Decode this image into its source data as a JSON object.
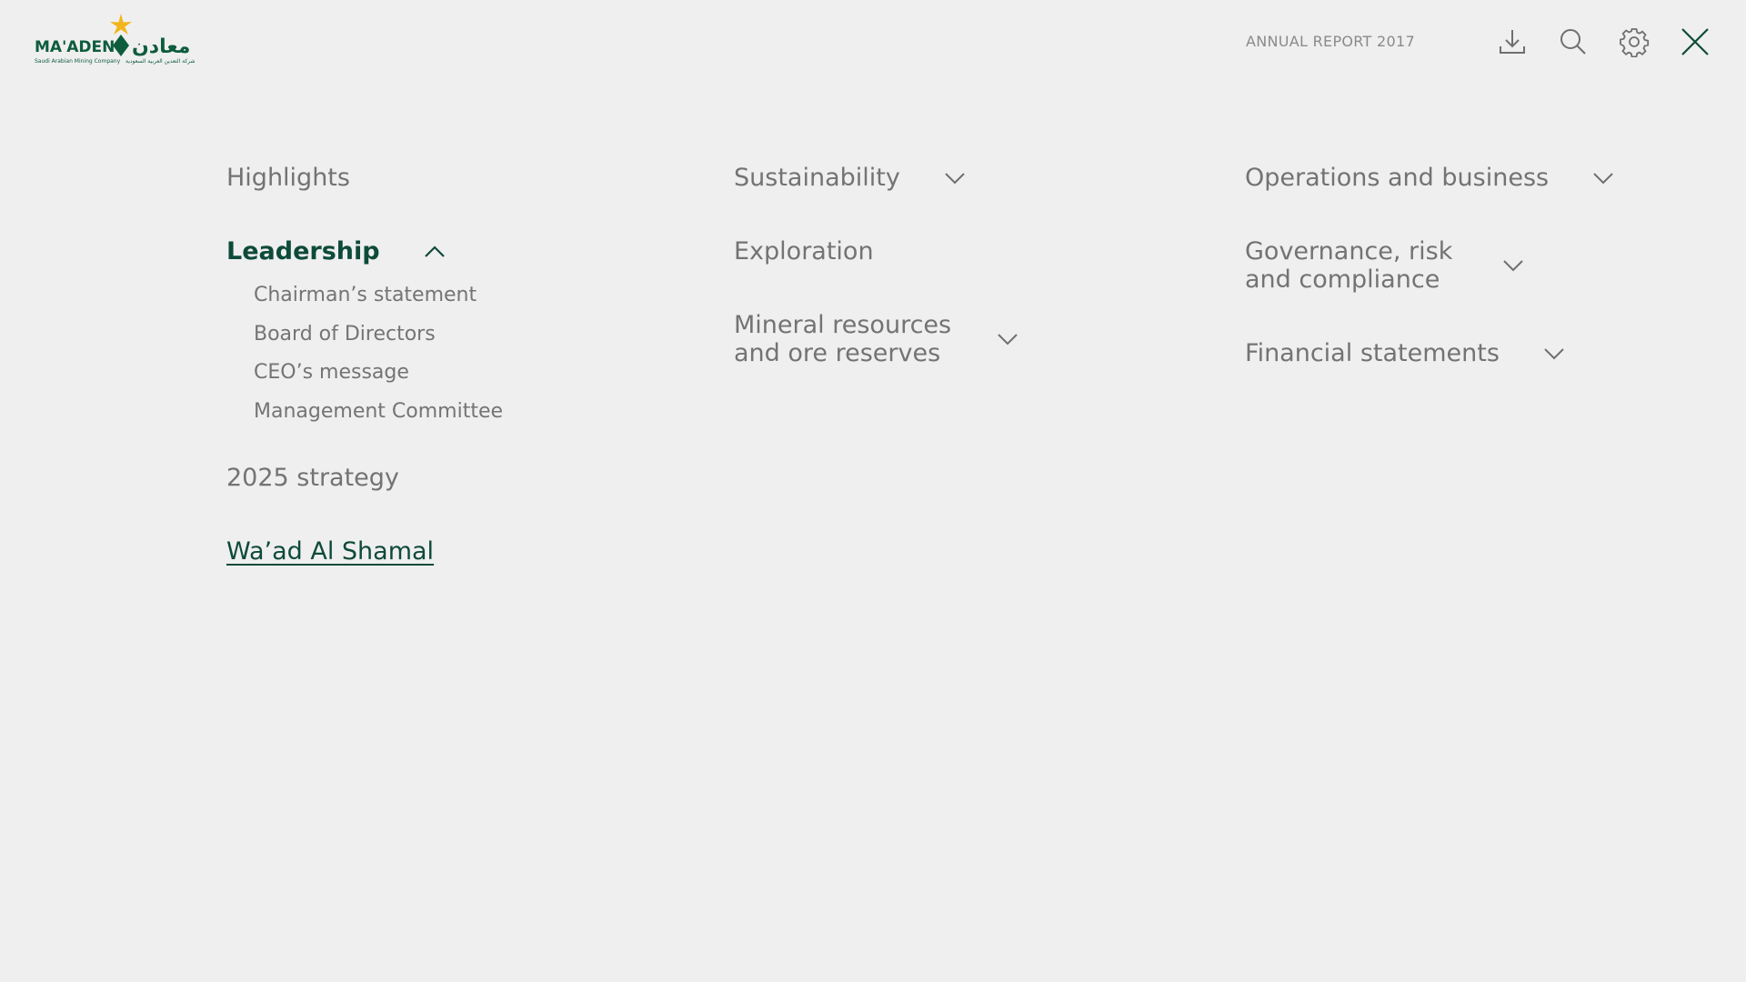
{
  "header": {
    "logo": {
      "brand_text": "MA'ADEN",
      "arabic_text": "معادن",
      "tagline": "Saudi Arabian Mining Company",
      "arabic_tagline": "شركة التعدين العربية السعودية",
      "brand_color": "#0e5c3e",
      "star_color": "#f2b51b"
    },
    "title": "ANNUAL REPORT 2017",
    "icons": [
      "download-icon",
      "search-icon",
      "settings-gear-icon",
      "close-icon"
    ]
  },
  "menu": {
    "col1": {
      "highlights": "Highlights",
      "leadership": "Leadership",
      "leadership_sub": [
        "Chairman’s statement",
        "Board of Directors",
        "CEO’s message",
        "Management Committee"
      ],
      "strategy": "2025 strategy",
      "waad": "Wa’ad Al Shamal"
    },
    "col2": {
      "sustainability": "Sustainability",
      "exploration": "Exploration",
      "mineral": "Mineral resources\nand ore reserves"
    },
    "col3": {
      "operations": "Operations and business",
      "governance": "Governance, risk\nand compliance",
      "financial": "Financial statements"
    }
  },
  "colors": {
    "background": "#efefef",
    "accent": "#0e4a3a",
    "text": "#737373"
  }
}
